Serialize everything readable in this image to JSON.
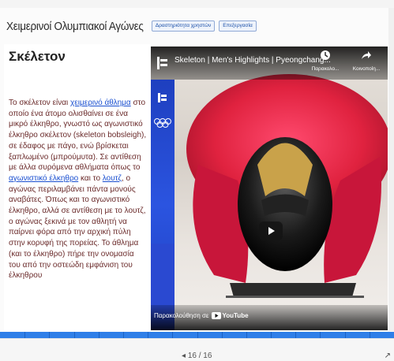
{
  "header": {
    "title": "Χειμερινοί Ολυμπιακοί Αγώνες",
    "buttons": [
      "Δραστηριότητα χρηστών",
      "Επεξεργασία"
    ]
  },
  "article": {
    "title": "Σκέλετον",
    "p1_a": "Το σκέλετον είναι ",
    "link_winter_sport": "χειμερινό άθλημα",
    "p1_b": " στο οποίο ένα άτομο ολισθαίνει σε ένα μικρό έλκηθρο, γνωστό ως αγωνιστικό έλκηθρο σκέλετον (skeleton bobsleigh), σε έδαφος με πάγο, ενώ βρίσκεται ξαπλωμένο (μπρούμυτα). Σε αντίθεση με άλλα συρόμενα αθλήματα όπως το ",
    "link_bobsleigh": "αγωνιστικό έλκηθρο",
    "p1_c": " και το ",
    "link_luge": "λουτζ",
    "p1_d": ", ο αγώνας περιλαμβάνει πάντα μονούς αναβάτες. Όπως και το αγωνιστικό έλκηθρο, αλλά σε αντίθεση με το λουτζ, ο αγώνας ξεκινά με τον αθλητή να παίρνει φόρα από την αρχική πύλη στην κορυφή της πορείας. Το άθλημα (και το έλκηθρο) πήρε την ονομασία του από την οστεώδη εμφάνιση του έλκηθρου"
  },
  "video": {
    "title": "Skeleton | Men's Highlights | Pyeongchang...",
    "watch_later": "Παρακολο...",
    "share": "Κοινοποίη...",
    "watch_on": "Παρακολούθηση σε",
    "youtube": "YouTube",
    "channel_icon": "olympic-channel-icon"
  },
  "pager": {
    "text": "16 / 16"
  },
  "colors": {
    "progress": "#2f7fe8",
    "link": "#1a4fd0",
    "text": "#6a2a2a",
    "video_side": "#2a49d1"
  }
}
